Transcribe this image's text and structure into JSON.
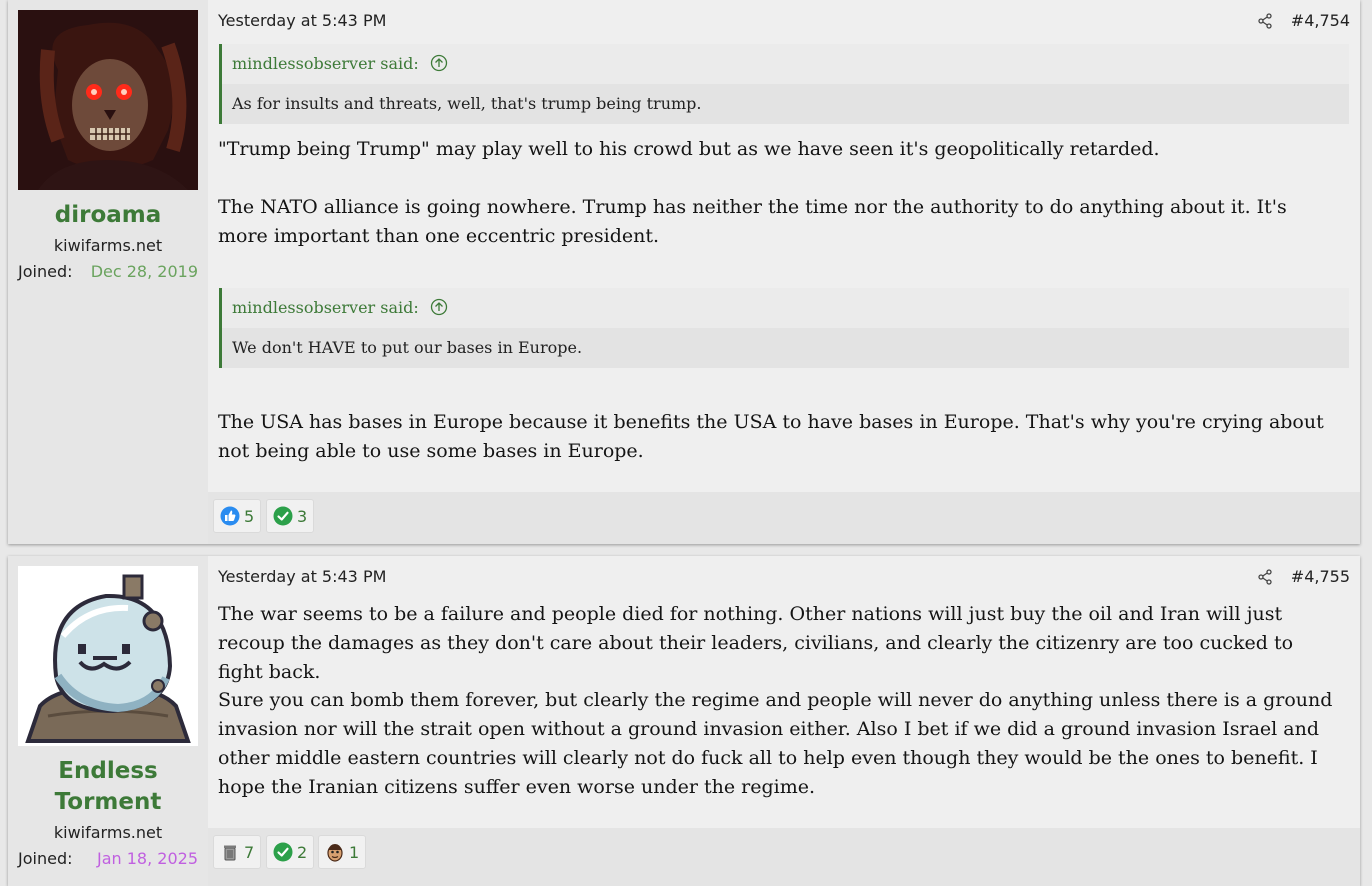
{
  "posts": [
    {
      "author": "diroama",
      "user_title": "kiwifarms.net",
      "joined_label": "Joined:",
      "joined_date": "Dec 28, 2019",
      "timestamp": "Yesterday at 5:43 PM",
      "post_number": "#4,754",
      "quotes": [
        {
          "author": "mindlessobserver said:",
          "text": "As for insults and threats, well, that's trump being trump."
        },
        {
          "author": "mindlessobserver said:",
          "text": "We don't HAVE to put our bases in Europe."
        }
      ],
      "paragraphs": [
        "\"Trump being Trump\" may play well to his crowd but as we have seen it's geopolitically retarded.",
        "The NATO alliance is going nowhere. Trump has neither the time nor the authority to do anything about it. It's more important than one eccentric president.",
        "The USA has bases in Europe because it benefits the USA to have bases in Europe. That's why you're crying about not being able to use some bases in Europe."
      ],
      "reactions": [
        {
          "icon": "thumbs-up-icon",
          "count": "5"
        },
        {
          "icon": "check-icon",
          "count": "3"
        }
      ]
    },
    {
      "author": "Endless Torment",
      "user_title": "kiwifarms.net",
      "joined_label": "Joined:",
      "joined_date": "Jan 18, 2025",
      "timestamp": "Yesterday at 5:43 PM",
      "post_number": "#4,755",
      "paragraphs": [
        "The war seems to be a failure and people died for nothing. Other nations will just buy the oil and Iran will just recoup the damages as they don't care about their leaders, civilians, and clearly the citizenry are too cucked to fight back.",
        "Sure you can bomb them forever, but clearly the regime and people will never do anything unless there is a ground invasion nor will the strait open without a ground invasion either. Also I bet if we did a ground invasion Israel and other middle eastern countries will clearly not do fuck all to help even though they would be the ones to benefit. I hope the Iranian citizens suffer even worse under the regime."
      ],
      "reactions": [
        {
          "icon": "trash-can-icon",
          "count": "7"
        },
        {
          "icon": "check-icon",
          "count": "2"
        },
        {
          "icon": "face-icon",
          "count": "1"
        }
      ]
    }
  ],
  "colors": {
    "accent_green": "#3d7a38",
    "joined_green": "#6aa35e",
    "joined_purple": "#c060e0",
    "background": "#e8e8e8"
  }
}
